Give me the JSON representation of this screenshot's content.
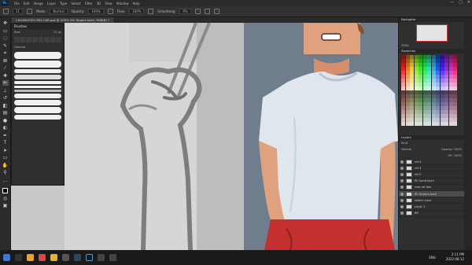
{
  "menubar": {
    "logo": "Ps",
    "items": [
      "File",
      "Edit",
      "Image",
      "Layer",
      "Type",
      "Select",
      "Filter",
      "3D",
      "View",
      "Window",
      "Help"
    ],
    "win_min": "—",
    "win_max": "▢",
    "win_close": "✕"
  },
  "options": {
    "size": "21",
    "mode_label": "Mode:",
    "mode_value": "Normal",
    "opacity_label": "Opacity:",
    "opacity_value": "100%",
    "flow_label": "Flow:",
    "flow_value": "100%",
    "smoothing_label": "Smoothing:",
    "smoothing_value": "0%"
  },
  "doc_tab": {
    "title": "CH4-BK-YOYO-SEX-CAR.psd @ 200% (RC fingers back, RGB/8) *"
  },
  "brushes_panel": {
    "title": "Brushes",
    "size_label": "Size:",
    "size_value": "21 px",
    "group_label": "General"
  },
  "navigator": {
    "title": "Navigator",
    "zoom": "200%"
  },
  "swatches": {
    "title": "Swatches"
  },
  "layers": {
    "title": "Layers",
    "kind_label": "Kind",
    "blend": "Normal",
    "opacity_label": "Opacity:",
    "opacity_value": "100%",
    "fill_label": "Fill:",
    "fill_value": "100%",
    "items": [
      {
        "name": "ref 4"
      },
      {
        "name": "ref 3"
      },
      {
        "name": "ref 2"
      },
      {
        "name": "RC hand back"
      },
      {
        "name": "new ref few"
      },
      {
        "name": "RC fingers back"
      },
      {
        "name": "sketch rises"
      },
      {
        "name": "Layer 1"
      },
      {
        "name": "BG"
      }
    ],
    "selected_index": 5
  },
  "taskbar": {
    "lang": "ENG",
    "time": "2:11 PM",
    "date": "2022-08-12"
  },
  "colors": {
    "shirt": "#dfe6ee",
    "skin": "#e0a27e",
    "shorts": "#c42f2f",
    "hair": "#8e4a2a",
    "bg_right": "#6f7d8c"
  }
}
